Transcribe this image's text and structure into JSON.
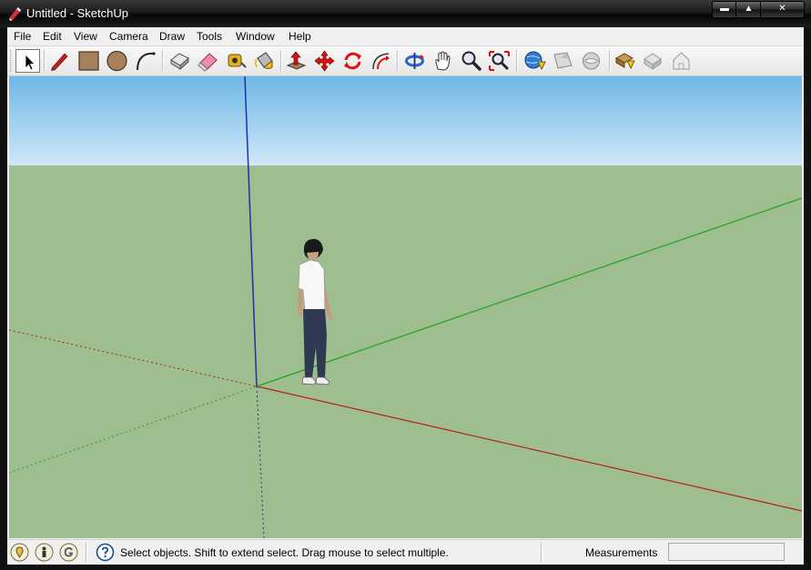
{
  "window": {
    "title": "Untitled - SketchUp"
  },
  "window_controls": {
    "minimize": "▬",
    "maximize": "▲",
    "close": "✕"
  },
  "menu": [
    "File",
    "Edit",
    "View",
    "Camera",
    "Draw",
    "Tools",
    "Window",
    "Help"
  ],
  "toolbar": {
    "tools": [
      {
        "name": "select-tool",
        "icon": "arrow-cursor-icon",
        "selected": true
      },
      {
        "name": "line-tool",
        "icon": "pencil-icon"
      },
      {
        "name": "rectangle-tool",
        "icon": "rectangle-icon"
      },
      {
        "name": "circle-tool",
        "icon": "circle-icon"
      },
      {
        "name": "arc-tool",
        "icon": "arc-icon"
      },
      {
        "name": "make-component-tool",
        "icon": "component-icon"
      },
      {
        "name": "eraser-tool",
        "icon": "eraser-icon"
      },
      {
        "name": "tape-measure-tool",
        "icon": "tape-measure-icon"
      },
      {
        "name": "paint-bucket-tool",
        "icon": "paint-bucket-icon"
      },
      {
        "name": "push-pull-tool",
        "icon": "push-pull-icon"
      },
      {
        "name": "move-tool",
        "icon": "move-icon"
      },
      {
        "name": "rotate-tool",
        "icon": "rotate-icon"
      },
      {
        "name": "offset-tool",
        "icon": "offset-icon"
      },
      {
        "name": "orbit-tool",
        "icon": "orbit-icon"
      },
      {
        "name": "pan-tool",
        "icon": "hand-icon"
      },
      {
        "name": "zoom-tool",
        "icon": "magnifier-icon"
      },
      {
        "name": "zoom-extents-tool",
        "icon": "zoom-extents-icon"
      },
      {
        "name": "get-models-tool",
        "icon": "warehouse-globe-icon"
      },
      {
        "name": "share-model-tool",
        "icon": "share-model-icon"
      },
      {
        "name": "share-component-tool",
        "icon": "share-component-icon"
      },
      {
        "name": "get-photo-texture-tool",
        "icon": "photo-texture-icon"
      },
      {
        "name": "extension-warehouse-tool",
        "icon": "extension-icon"
      },
      {
        "name": "preview-3d-tool",
        "icon": "house-icon"
      }
    ]
  },
  "colors": {
    "sky_top": "#6fb7e6",
    "sky_bottom": "#cfe8f7",
    "ground": "#9ebe8f",
    "red_axis": "#b52020",
    "green_axis": "#1ea61e",
    "blue_axis": "#1f2fb0"
  },
  "status": {
    "icons": [
      "geo-location-icon",
      "credits-icon",
      "google-sign-in-icon",
      "help-icon"
    ],
    "text": "Select objects. Shift to extend select. Drag mouse to select multiple.",
    "measurements_label": "Measurements",
    "measurements_value": ""
  }
}
